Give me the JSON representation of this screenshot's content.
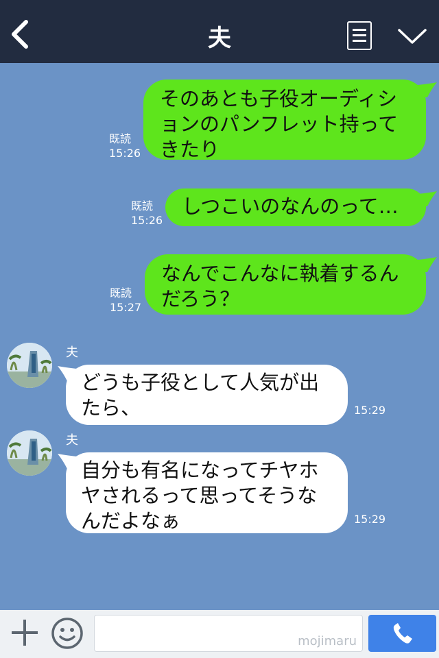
{
  "header": {
    "title": "夫"
  },
  "messages": [
    {
      "read": "既読",
      "time": "15:26",
      "text": "そのあとも子役オーディションのパンフレット持ってきたり"
    },
    {
      "read": "既読",
      "time": "15:26",
      "text": "しつこいのなんのって…"
    },
    {
      "read": "既読",
      "time": "15:27",
      "text": "なんでこんなに執着するんだろう？"
    },
    {
      "sender": "夫",
      "time": "15:29",
      "text": "どうも子役として人気が出たら、"
    },
    {
      "sender": "夫",
      "time": "15:29",
      "text": "自分も有名になってチヤホヤされるって思ってそうなんだよなぁ"
    }
  ],
  "input": {
    "watermark": "mojimaru"
  },
  "colors": {
    "header_bg": "#222c40",
    "chat_bg": "#6b93c6",
    "outgoing_bubble": "#5ee51c",
    "incoming_bubble": "#ffffff",
    "call_button": "#3f82e8"
  },
  "icons": [
    "back-icon",
    "menu-icon",
    "chevron-down-icon",
    "plus-icon",
    "smile-icon",
    "phone-icon"
  ]
}
